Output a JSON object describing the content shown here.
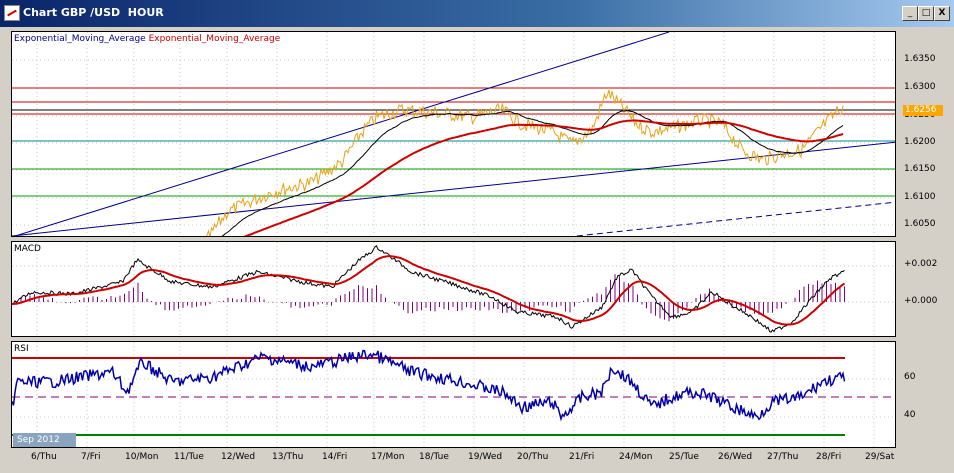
{
  "window": {
    "title": "Chart GBP /USD  HOUR",
    "buttons": {
      "minimize": "_",
      "maximize": "□",
      "close": "X"
    }
  },
  "price_panel": {
    "legend": {
      "ema_fast": "Exponential_Moving_Average",
      "ema_slow": "Exponential_Moving_Average"
    },
    "y_labels": [
      "1.6350",
      "1.6300",
      "1.6250",
      "1.6200",
      "1.6150",
      "1.6100",
      "1.6050"
    ],
    "current_price": "1.6256",
    "colors": {
      "price": "#e8a317",
      "ema_fast": "#000000",
      "ema_slow": "#cc0000",
      "trend": "#00008b",
      "support": "#00a000",
      "resistance": "#cc0000"
    }
  },
  "macd_panel": {
    "title": "MACD",
    "y_labels": [
      "+0.002",
      "+0.000"
    ],
    "colors": {
      "macd": "#000000",
      "signal": "#cc0000",
      "histogram": "#800080"
    }
  },
  "rsi_panel": {
    "title": "RSI",
    "y_labels": [
      "60",
      "40"
    ],
    "colors": {
      "rsi": "#0000aa",
      "overbought": "#cc0000",
      "oversold": "#008000",
      "mid": "#800080"
    }
  },
  "x_axis": {
    "labels": [
      "6/Thu",
      "7/Fri",
      "10/Mon",
      "11/Tue",
      "12/Wed",
      "13/Thu",
      "14/Fri",
      "17/Mon",
      "18/Tue",
      "19/Wed",
      "20/Thu",
      "21/Fri",
      "24/Mon",
      "25/Tue",
      "26/Wed",
      "27/Thu",
      "28/Fri",
      "29/Sat"
    ],
    "month_badge": "Sep 2012"
  }
}
